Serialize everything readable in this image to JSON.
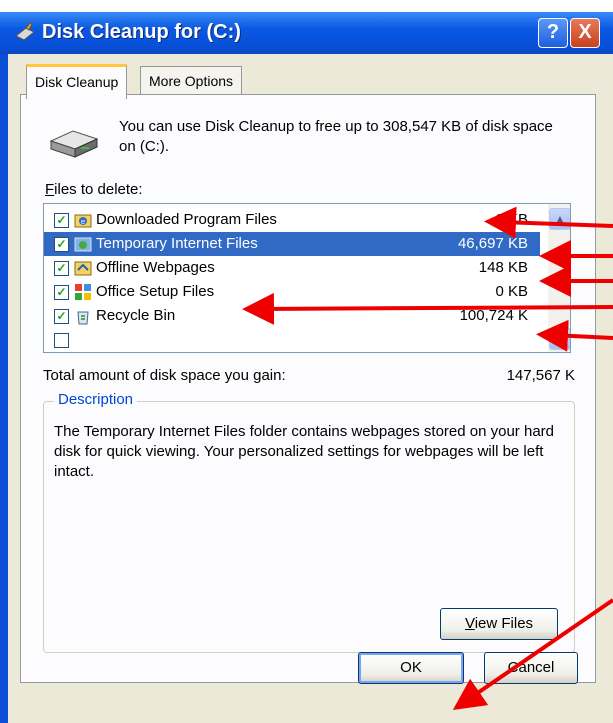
{
  "window": {
    "title": "Disk Cleanup for  (C:)",
    "help_label": "?",
    "close_label": "X"
  },
  "tabs": [
    {
      "label": "Disk Cleanup",
      "active": true
    },
    {
      "label": "More Options",
      "active": false
    }
  ],
  "intro_text": "You can use Disk Cleanup to free up to 308,547 KB of disk space on  (C:).",
  "files_label_mnemonic": "F",
  "files_label_rest": "iles to delete:",
  "files": [
    {
      "name": "Downloaded Program Files",
      "size": "0 KB",
      "checked": true,
      "selected": false,
      "icon": "ie-folder-icon"
    },
    {
      "name": "Temporary Internet Files",
      "size": "46,697 KB",
      "checked": true,
      "selected": true,
      "icon": "ie-globe-icon"
    },
    {
      "name": "Offline Webpages",
      "size": "148 KB",
      "checked": true,
      "selected": false,
      "icon": "offline-pages-icon"
    },
    {
      "name": "Office Setup Files",
      "size": "0 KB",
      "checked": true,
      "selected": false,
      "icon": "office-icon"
    },
    {
      "name": "Recycle Bin",
      "size": "100,724 K",
      "checked": true,
      "selected": false,
      "icon": "recycle-bin-icon"
    }
  ],
  "total_label": "Total amount of disk space you gain:",
  "total_value": "147,567 K",
  "description": {
    "legend": "Description",
    "text": "The Temporary Internet Files folder contains webpages stored on your hard disk for quick viewing. Your personalized settings for webpages will be left intact."
  },
  "buttons": {
    "view_files_mnemonic": "V",
    "view_files_rest": "iew Files",
    "ok": "OK",
    "cancel": "Cancel"
  },
  "colors": {
    "titlebar": "#0a58e3",
    "selection": "#316ac5",
    "annotation_arrow": "#ee0000"
  }
}
